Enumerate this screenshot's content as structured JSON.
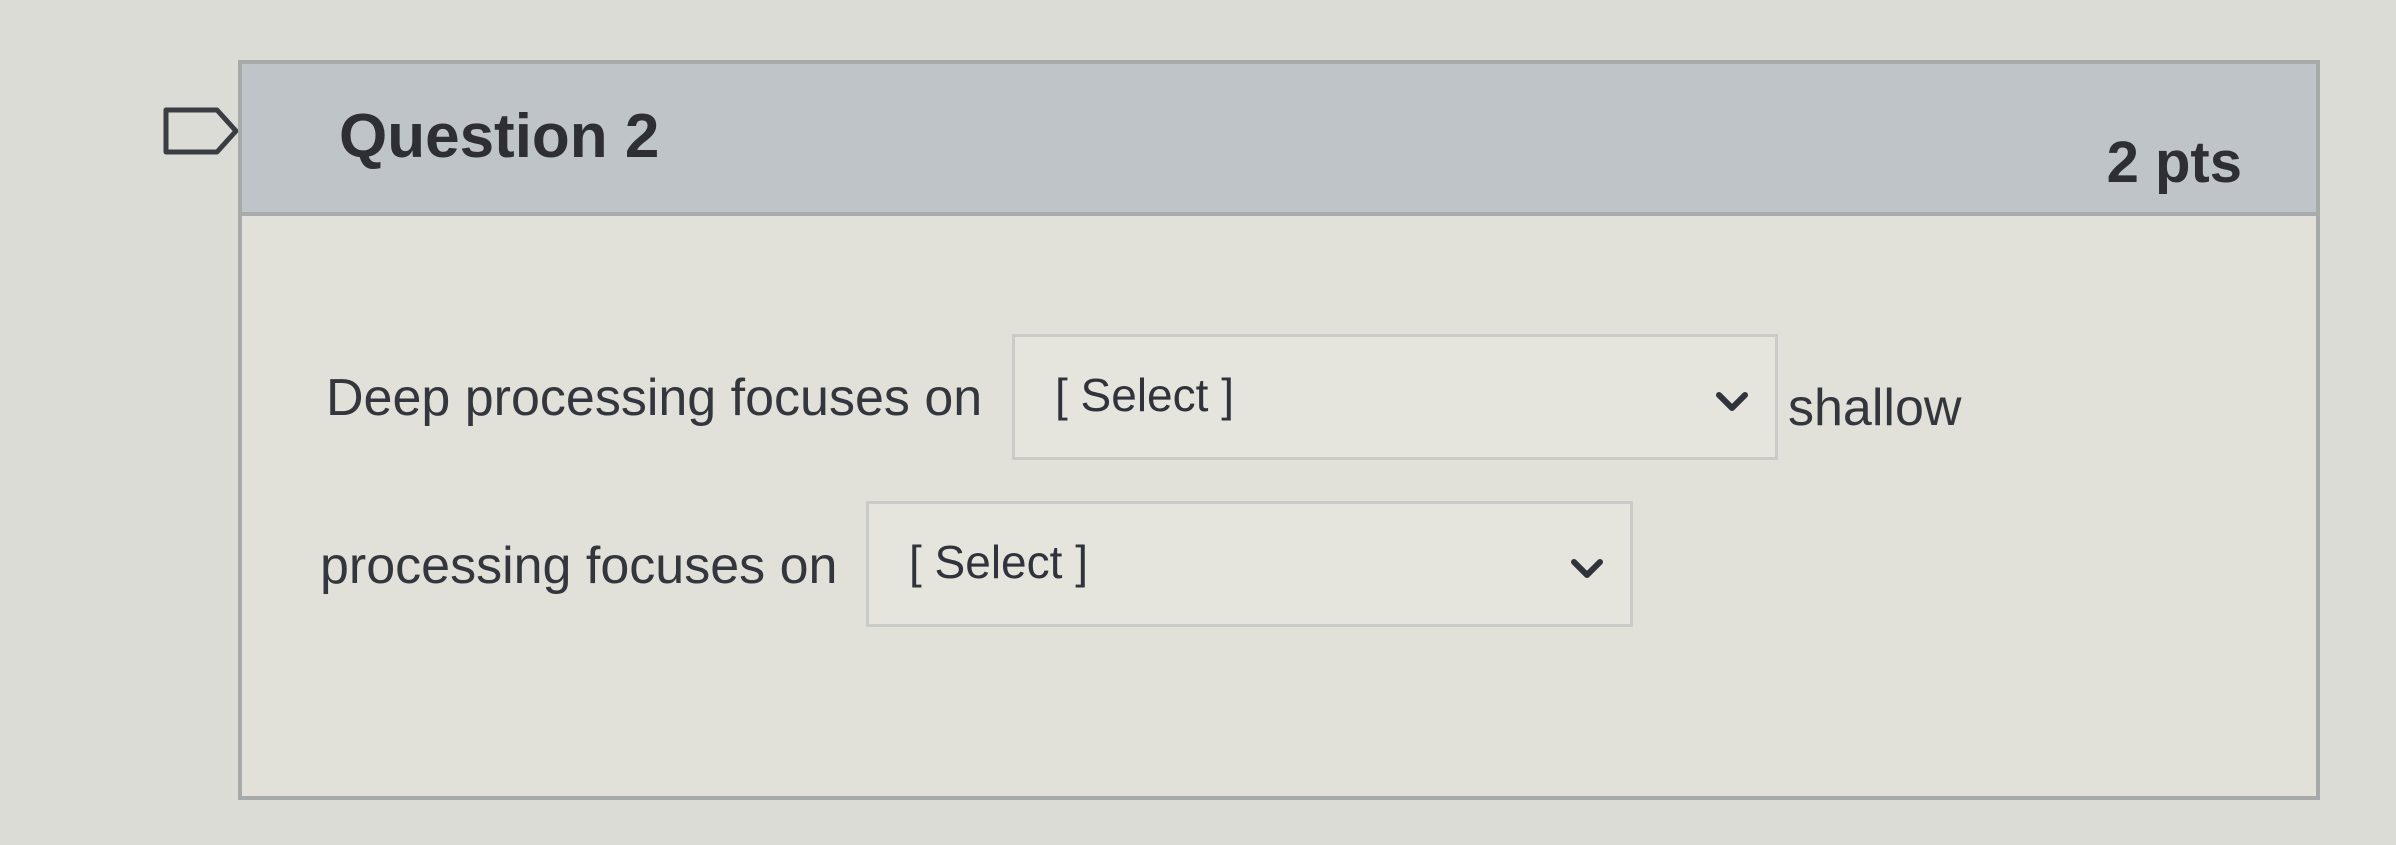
{
  "question": {
    "title": "Question 2",
    "points": "2 pts",
    "sentence": {
      "part1": "Deep processing focuses on",
      "part2": "shallow",
      "part3": "processing focuses on"
    },
    "dropdowns": [
      {
        "selected": "[ Select ]"
      },
      {
        "selected": "[ Select ]"
      }
    ]
  },
  "icons": {
    "flag": "flag-icon",
    "chevron": "chevron-down-icon"
  },
  "colors": {
    "header_background": "#bfc4c8",
    "card_background": "#e1e1da",
    "border": "#a6aaa8",
    "text": "#34363d"
  }
}
